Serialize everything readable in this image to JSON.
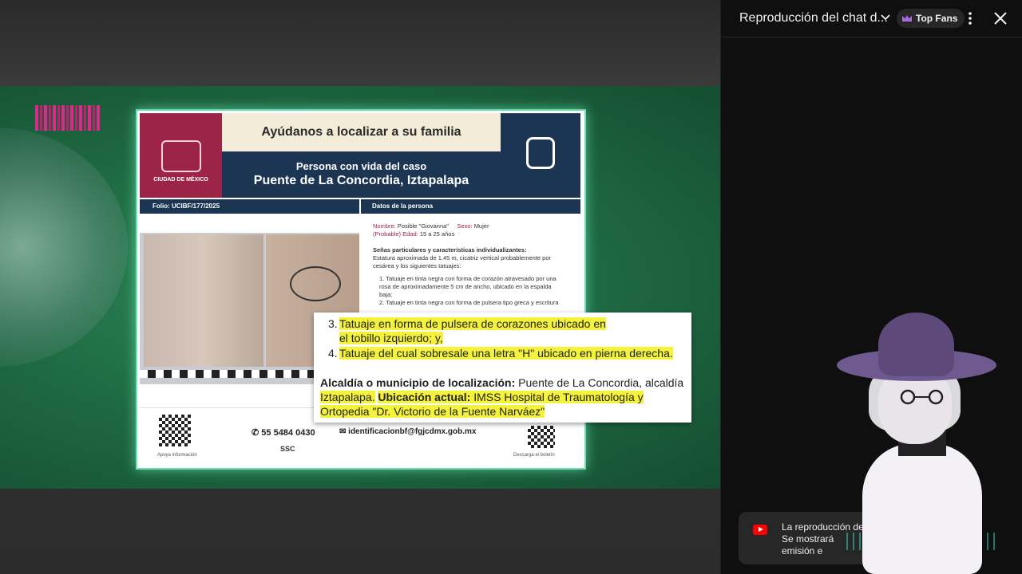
{
  "video": {
    "poster": {
      "header_title": "Ayúdanos a localizar a su familia",
      "header_subtitle": "Persona con vida del caso",
      "header_case": "Puente de La Concordia, Iztapalapa",
      "left_logo_text": "CIUDAD DE MÉXICO",
      "folio": "Folio: UCIBF/177/2025",
      "datos_label": "Datos de la persona",
      "nombre_label": "Nombre:",
      "nombre_value": "Posible \"Giovanna\"",
      "sexo_label": "Sexo:",
      "sexo_value": "Mujer",
      "probable": "(Probable)",
      "edad_label": "Edad:",
      "edad_value": "15 a 25 años",
      "senas_heading": "Señas particulares y características individualizantes:",
      "senas_text": "Estatura aproximada de 1.45 m, cicatriz vertical probablemente por cesárea y los siguientes tatuajes:",
      "tattoo_1": "1. Tatuaje en tinta negra con forma de corazón atravesado por una rosa de aproximadamente 5 cm de ancho, ubicado en la espalda baja;",
      "tattoo_2": "2. Tatuaje en tinta negra con forma de pulsera tipo greca y escritura",
      "phone": "55 5484 0430",
      "email": "identificacionbf@fgjcdmx.gob.mx",
      "qr_left_caption": "Apoya información",
      "qr_right_caption": "Descarga el boletín",
      "footer_logo_ssc": "SSC"
    },
    "zoom": {
      "item3_num": "3.",
      "item3_line1": "Tatuaje en forma de pulsera de corazones ubicado en",
      "item3_line2": "el tobillo izquierdo; y,",
      "item4_num": "4.",
      "item4_text": "Tatuaje del cual sobresale una letra \"H\" ubicado en pierna derecha.",
      "alcaldia_label": "Alcaldía o municipio de localización:",
      "alcaldia_value_1": "Puente de La Concordia, alcaldía",
      "alcaldia_value_2": "Iztapalapa.",
      "ubicacion_label": "Ubicación actual:",
      "ubicacion_value_1": "IMSS Hospital de Traumatología y",
      "ubicacion_value_2": "Ortopedia \"Dr. Victorio de la Fuente Narváez\""
    }
  },
  "chat": {
    "title": "Reproducción del chat d...",
    "top_fans_label": "Top Fans",
    "notice_line1": "La reproducción del chat",
    "notice_line2": "Se mostrará",
    "notice_line3": "emisión e"
  },
  "colors": {
    "poster_maroon": "#9c2449",
    "poster_navy": "#1c3553",
    "highlight": "#f4f23a",
    "chat_bg": "#0f0f0f",
    "green_bg": "#1f6d44"
  }
}
